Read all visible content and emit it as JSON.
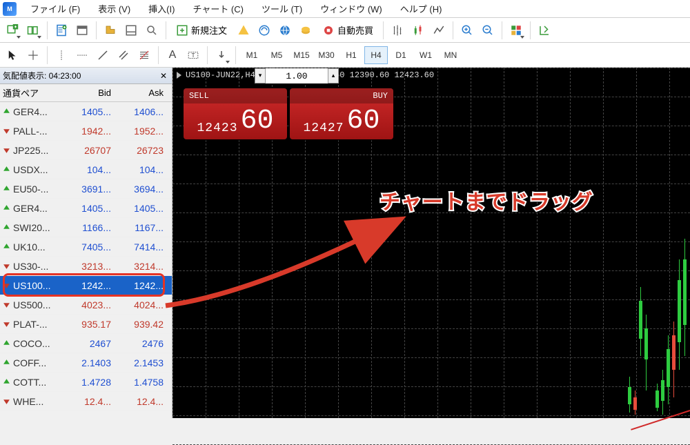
{
  "menu": [
    {
      "label": "ファイル (F)"
    },
    {
      "label": "表示 (V)"
    },
    {
      "label": "挿入(I)"
    },
    {
      "label": "チャート (C)"
    },
    {
      "label": "ツール (T)"
    },
    {
      "label": "ウィンドウ (W)"
    },
    {
      "label": "ヘルプ (H)"
    }
  ],
  "toolbar1": {
    "new_order_label": "新規注文",
    "auto_trade_label": "自動売買"
  },
  "timeframes": [
    {
      "label": "M1",
      "active": false
    },
    {
      "label": "M5",
      "active": false
    },
    {
      "label": "M15",
      "active": false
    },
    {
      "label": "M30",
      "active": false
    },
    {
      "label": "H1",
      "active": false
    },
    {
      "label": "H4",
      "active": true
    },
    {
      "label": "D1",
      "active": false
    },
    {
      "label": "W1",
      "active": false
    },
    {
      "label": "MN",
      "active": false
    }
  ],
  "market_watch": {
    "title": "気配値表示: 04:23:00",
    "columns": {
      "symbol": "通貨ペア",
      "bid": "Bid",
      "ask": "Ask"
    },
    "highlight_index": 9,
    "rows": [
      {
        "dir": "up",
        "symbol": "GER4...",
        "bid": "1405...",
        "ask": "1406..."
      },
      {
        "dir": "dn",
        "symbol": "PALL-...",
        "bid": "1942...",
        "ask": "1952..."
      },
      {
        "dir": "dn",
        "symbol": "JP225...",
        "bid": "26707",
        "ask": "26723"
      },
      {
        "dir": "up",
        "symbol": "USDX...",
        "bid": "104...",
        "ask": "104..."
      },
      {
        "dir": "up",
        "symbol": "EU50-...",
        "bid": "3691...",
        "ask": "3694..."
      },
      {
        "dir": "up",
        "symbol": "GER4...",
        "bid": "1405...",
        "ask": "1405..."
      },
      {
        "dir": "up",
        "symbol": "SWI20...",
        "bid": "1166...",
        "ask": "1167..."
      },
      {
        "dir": "up",
        "symbol": "UK10...",
        "bid": "7405...",
        "ask": "7414..."
      },
      {
        "dir": "dn",
        "symbol": "US30-...",
        "bid": "3213...",
        "ask": "3214..."
      },
      {
        "dir": "dn",
        "symbol": "US100...",
        "bid": "1242...",
        "ask": "1242...",
        "selected": true
      },
      {
        "dir": "dn",
        "symbol": "US500...",
        "bid": "4023...",
        "ask": "4024..."
      },
      {
        "dir": "dn",
        "symbol": "PLAT-...",
        "bid": "935.17",
        "ask": "939.42"
      },
      {
        "dir": "up",
        "symbol": "COCO...",
        "bid": "2467",
        "ask": "2476"
      },
      {
        "dir": "up",
        "symbol": "COFF...",
        "bid": "2.1403",
        "ask": "2.1453"
      },
      {
        "dir": "up",
        "symbol": "COTT...",
        "bid": "1.4728",
        "ask": "1.4758"
      },
      {
        "dir": "dn",
        "symbol": "WHE...",
        "bid": "12.4...",
        "ask": "12.4..."
      }
    ]
  },
  "chart": {
    "title_line": "US100-JUN22,H4  12407.40 12496.50 12390.60 12423.60",
    "sell_label": "SELL",
    "buy_label": "BUY",
    "volume": "1.00",
    "sell_price_pre": "12423",
    "sell_price_big": "60",
    "buy_price_pre": "12427",
    "buy_price_big": "60"
  },
  "annotation": "チャートまでドラッグ"
}
